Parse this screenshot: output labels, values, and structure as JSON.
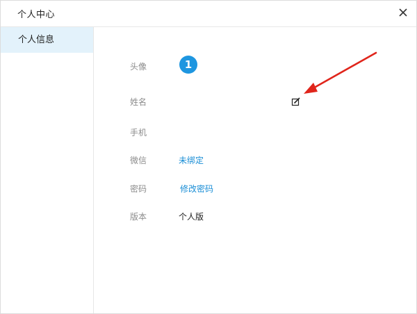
{
  "dialog": {
    "title": "个人中心",
    "close_icon": "close-icon"
  },
  "sidebar": {
    "items": [
      {
        "label": "个人信息",
        "active": true
      }
    ]
  },
  "profile": {
    "avatar": {
      "label": "头像",
      "text": "1",
      "color": "#1e96e0"
    },
    "name": {
      "label": "姓名",
      "value": "",
      "edit_icon": "edit-icon"
    },
    "phone": {
      "label": "手机",
      "value": ""
    },
    "wechat": {
      "label": "微信",
      "value": "未绑定"
    },
    "password": {
      "label": "密码",
      "value": "修改密码"
    },
    "version": {
      "label": "版本",
      "value": "个人版"
    }
  },
  "colors": {
    "link": "#1a8ed6",
    "active_bg": "#e3f2fb",
    "annotation_arrow": "#e0251b"
  }
}
